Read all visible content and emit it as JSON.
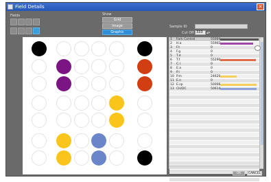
{
  "window": {
    "title": "Field Details",
    "close_glyph": "✕"
  },
  "fields": {
    "label": "Fields"
  },
  "show": {
    "label": "Show",
    "buttons": [
      {
        "label": "Grid",
        "active": false
      },
      {
        "label": "Image",
        "active": false
      },
      {
        "label": "Graphic",
        "active": true
      }
    ]
  },
  "sample": {
    "label": "Sample ID",
    "value": ""
  },
  "cutoff": {
    "label": "Cut Off",
    "value": "333"
  },
  "wells": [
    [
      "black",
      "empty",
      "empty",
      "empty",
      "empty",
      "black"
    ],
    [
      "empty",
      "purple",
      "empty",
      "empty",
      "empty",
      "red"
    ],
    [
      "empty",
      "purple",
      "empty",
      "empty",
      "empty",
      "red"
    ],
    [
      "empty",
      "empty",
      "empty",
      "empty",
      "yellow",
      "empty"
    ],
    [
      "empty",
      "empty",
      "empty",
      "empty",
      "yellow",
      "empty"
    ],
    [
      "empty",
      "yellow",
      "empty",
      "blue",
      "empty",
      "empty"
    ],
    [
      "empty",
      "yellow",
      "empty",
      "blue",
      "empty",
      "black"
    ]
  ],
  "colors": {
    "black": "#000000",
    "purple": "#7b1583",
    "red": "#d03e12",
    "yellow": "#f9c51a",
    "blue": "#6b86c8",
    "accent": "#2e8ed8"
  },
  "table": {
    "rows": [
      {
        "num": "1",
        "name": "Fork Control",
        "value": "55004",
        "bar": "#555555",
        "bar_level": 1.0
      },
      {
        "num": "2",
        "name": "H.a",
        "value": "55902",
        "bar": "#a04aa8",
        "bar_level": 0.85
      },
      {
        "num": "3",
        "name": "F.t",
        "value": "0",
        "bar": "",
        "bar_level": 0
      },
      {
        "num": "4",
        "name": "F.g",
        "value": "0",
        "bar": "",
        "bar_level": 0
      },
      {
        "num": "5",
        "name": "T.d",
        "value": "0",
        "bar": "",
        "bar_level": 0
      },
      {
        "num": "6",
        "name": "T.f",
        "value": "55290",
        "bar": "#e06b4a",
        "bar_level": 0.92
      },
      {
        "num": "7",
        "name": "C.l",
        "value": "0",
        "bar": "",
        "bar_level": 0
      },
      {
        "num": "8",
        "name": "E.a",
        "value": "0",
        "bar": "",
        "bar_level": 0
      },
      {
        "num": "9",
        "name": "P.i",
        "value": "0",
        "bar": "",
        "bar_level": 0
      },
      {
        "num": "10",
        "name": "P.m",
        "value": "24620",
        "bar": "#f6d05a",
        "bar_level": 0.42
      },
      {
        "num": "11",
        "name": "E.n",
        "value": "0",
        "bar": "",
        "bar_level": 0
      },
      {
        "num": "12",
        "name": "E.sp",
        "value": "50006",
        "bar": "#f6d05a",
        "bar_level": 0.95
      },
      {
        "num": "13",
        "name": "CH/DC",
        "value": "50614",
        "bar": "#8fa2d8",
        "bar_level": 0.95
      }
    ],
    "empty_rows": 22
  },
  "footer": {
    "ok_label": "OK",
    "cancel_label": "CANCEL"
  }
}
